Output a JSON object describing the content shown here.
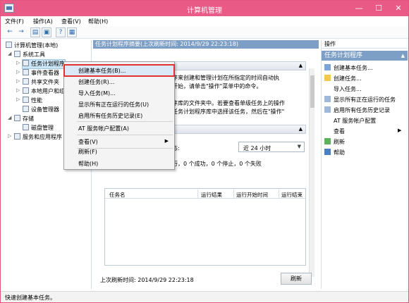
{
  "window": {
    "title": "计算机管理",
    "minimize": "—",
    "maximize": "☐",
    "close": "✕"
  },
  "menu": [
    "文件(F)",
    "操作(A)",
    "查看(V)",
    "帮助(H)"
  ],
  "toolbar": {
    "back": "←",
    "forward": "→",
    "b3": "▤",
    "b4": "▣",
    "b5": "?",
    "b6": "▦"
  },
  "tree": {
    "root": "计算机管理(本地)",
    "system_tools": "系统工具",
    "task_scheduler": "任务计划程序",
    "event_viewer": "事件查看器",
    "shared_folders": "共享文件夹",
    "local_users": "本地用户和组",
    "performance": "性能",
    "device_manager": "设备管理器",
    "storage": "存储",
    "disk_management": "磁盘管理",
    "services": "服务和应用程序"
  },
  "center": {
    "header": "任务计划程序摘要(上次刷新时间: 2014/9/29 22:23:18)",
    "text1": "序来创建和管理计划在所指定的时间自动执",
    "text2": "开始，请单击\"操作\"菜单中的命令。",
    "text3": "序库的文件夹中。若要查看单级任务上的操作",
    "text4": "任务计划程序库中选择该任务，然后在\"操作\"",
    "status_label": "态:",
    "select_value": "近 24 小时",
    "counts": "行，0 个成功，0 个停止，0 个失败",
    "columns": [
      "任务名",
      "运行结果",
      "运行开始时间",
      "运行结束"
    ],
    "last_refresh": "上次刷新时间: 2014/9/29 22:23:18",
    "refresh": "刷新"
  },
  "actions": {
    "header": "操作",
    "section": "任务计划程序",
    "items": [
      "创建基本任务...",
      "创建任务...",
      "导入任务...",
      "显示所有正在运行的任务",
      "启用所有任务历史记录",
      "AT 服务帐户配置",
      "查看",
      "刷新",
      "帮助"
    ]
  },
  "context_menu": {
    "items": [
      "创建基本任务(B)...",
      "创建任务(R)...",
      "导入任务(M)...",
      "显示所有正在运行的任务(U)",
      "启用所有任务历史记录(E)",
      "AT 服务帐户配置(A)",
      "查看(V)",
      "刷新(F)",
      "帮助(H)"
    ]
  },
  "status": "快速创建基本任务。"
}
